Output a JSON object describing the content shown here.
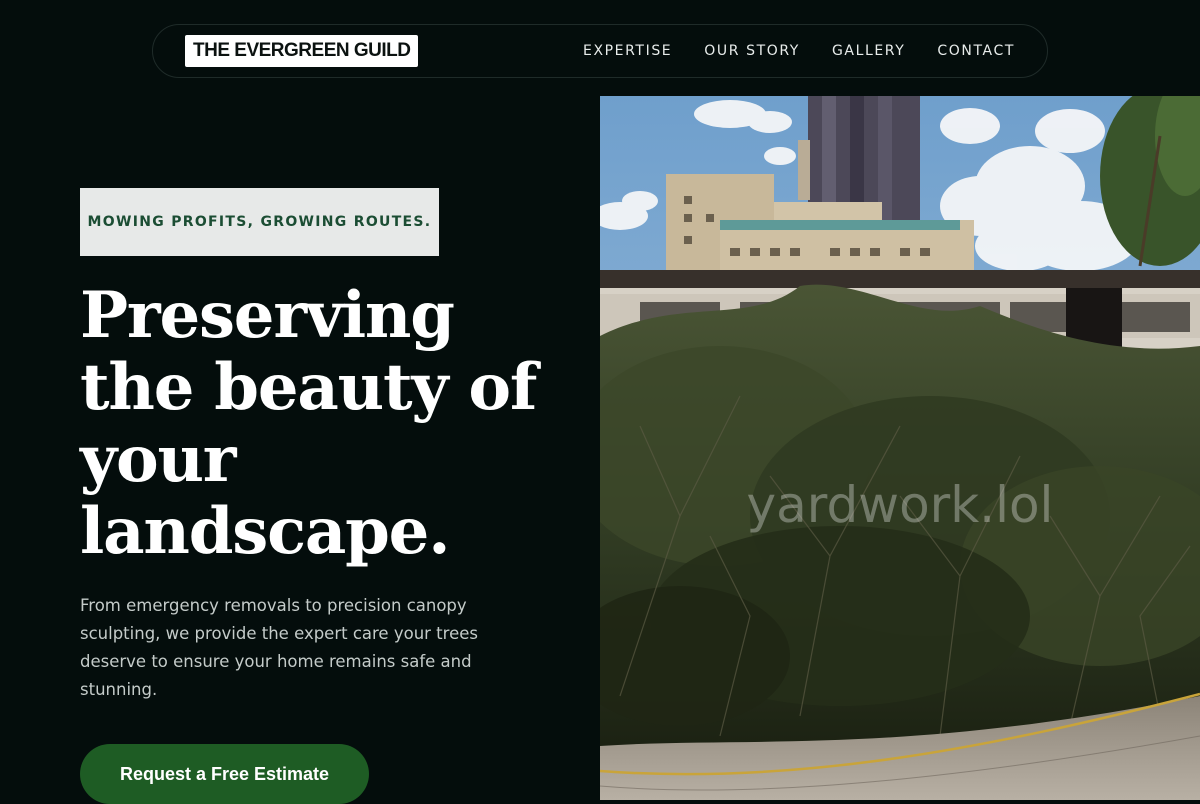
{
  "nav": {
    "logo": "THE EVERGREEN GUILD",
    "links": [
      "EXPERTISE",
      "OUR STORY",
      "GALLERY",
      "CONTACT"
    ]
  },
  "hero": {
    "tagline": "MOWING PROFITS, GROWING ROUTES.",
    "title": "Preserving the beauty of your landscape.",
    "description": "From emergency removals to precision canopy sculpting, we provide the expert care your trees deserve to ensure your home remains safe and stunning.",
    "cta_label": "Request a Free Estimate",
    "image_watermark": "yardwork.lol"
  },
  "colors": {
    "background": "#040d0c",
    "accent_green": "#1e5c24",
    "tagline_bg": "#e7e9e8",
    "tagline_text": "#1b4d33"
  }
}
